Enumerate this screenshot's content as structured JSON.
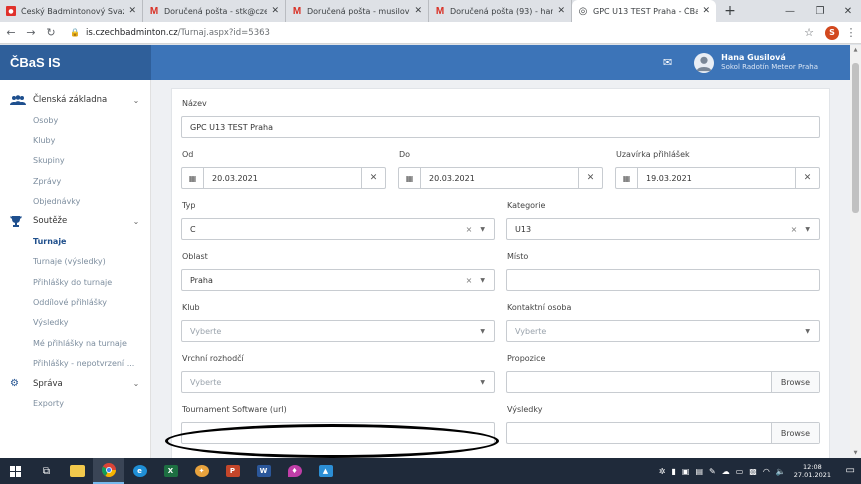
{
  "browser": {
    "tabs": [
      {
        "title": "Český Badmintonový Svaz — I",
        "favicon": "cbs-logo"
      },
      {
        "title": "Doručená pošta - stk@czechb",
        "favicon": "gmail-icon"
      },
      {
        "title": "Doručená pošta - musilova@c",
        "favicon": "gmail-icon"
      },
      {
        "title": "Doručená pošta (93) - hana.m",
        "favicon": "gmail-icon"
      },
      {
        "title": "GPC U13 TEST Praha - ČBaS IS",
        "favicon": "globe-icon",
        "active": true
      }
    ],
    "url_host": "is.czechbadminton.cz",
    "url_path": "/Turnaj.aspx?id=5363",
    "profile_initial": "S"
  },
  "app": {
    "brand": "ČBaS IS",
    "user_name": "Hana Gusilová",
    "user_club": "Sokol Radotín Meteor Praha",
    "header_color": "#3c74b8"
  },
  "sidebar": {
    "groups": [
      {
        "label": "Členská základna",
        "icon": "users-icon",
        "items": [
          "Osoby",
          "Kluby",
          "Skupiny",
          "Zprávy",
          "Objednávky"
        ]
      },
      {
        "label": "Soutěže",
        "icon": "trophy-icon",
        "items": [
          "Turnaje",
          "Turnaje (výsledky)",
          "Přihlášky do turnaje",
          "Oddílové přihlášky",
          "Výsledky",
          "Mé přihlášky na turnaje",
          "Přihlášky - nepotvrzení ..."
        ]
      },
      {
        "label": "Správa",
        "icon": "gear-icon",
        "items": [
          "Exporty"
        ]
      }
    ],
    "active_item": "Turnaje"
  },
  "form": {
    "nazev": {
      "label": "Název",
      "value": "GPC U13 TEST Praha"
    },
    "od": {
      "label": "Od",
      "value": "20.03.2021"
    },
    "do": {
      "label": "Do",
      "value": "20.03.2021"
    },
    "uzavirka": {
      "label": "Uzavírka přihlášek",
      "value": "19.03.2021"
    },
    "typ": {
      "label": "Typ",
      "value": "C"
    },
    "kategorie": {
      "label": "Kategorie",
      "value": "U13"
    },
    "oblast": {
      "label": "Oblast",
      "value": "Praha"
    },
    "misto": {
      "label": "Místo",
      "value": ""
    },
    "klub": {
      "label": "Klub",
      "placeholder": "Vyberte"
    },
    "kontakt": {
      "label": "Kontaktní osoba",
      "placeholder": "Vyberte"
    },
    "rozhodci": {
      "label": "Vrchní rozhodčí",
      "placeholder": "Vyberte"
    },
    "propozice": {
      "label": "Propozice",
      "button": "Browse"
    },
    "software": {
      "label": "Tournament Software (url)",
      "value": ""
    },
    "vysledky": {
      "label": "Výsledky",
      "button": "Browse"
    }
  },
  "taskbar": {
    "time": "12:08",
    "date": "27.01.2021"
  }
}
